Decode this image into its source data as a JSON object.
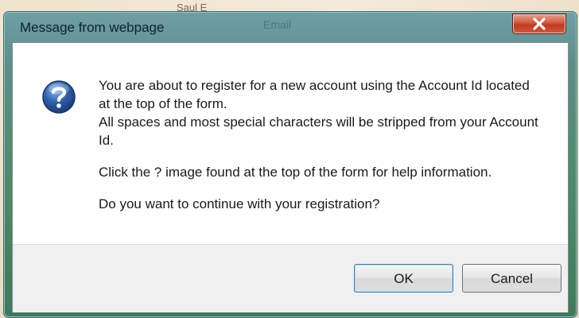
{
  "background": {
    "text": "Saul E"
  },
  "dialog": {
    "title": "Message from webpage",
    "ghost_text": "Email",
    "close_label": "X",
    "icon": "question-icon",
    "message": [
      "You are about to register for a new account using the Account Id located at the top of the form.",
      "All spaces and most special characters will be stripped from your Account Id.",
      "Click the ? image found at the top of the form for help information.",
      "Do you want to continue with your registration?"
    ],
    "buttons": {
      "ok": "OK",
      "cancel": "Cancel"
    }
  },
  "colors": {
    "close_button": "#c9452a",
    "frame": "#4f8a6a",
    "accent_icon": "#2f5ea8"
  }
}
